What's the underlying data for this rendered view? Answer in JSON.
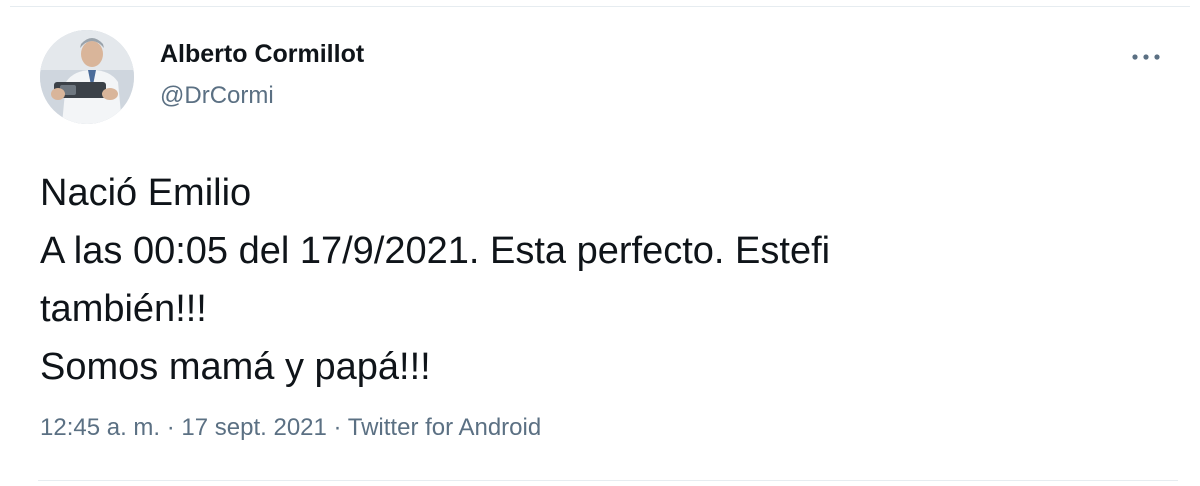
{
  "author": {
    "name": "Alberto Cormillot",
    "handle": "@DrCormi"
  },
  "menu_icon": "more-horizontal-icon",
  "body_lines": [
    "Nació Emilio",
    "A las 00:05 del 17/9/2021. Esta perfecto. Estefi",
    "también!!!",
    "Somos mamá y papá!!!"
  ],
  "meta": {
    "time": "12:45 a. m.",
    "separator": " · ",
    "date": "17 sept. 2021",
    "source": "Twitter for Android"
  },
  "colors": {
    "text": "#0f1419",
    "secondary": "#5b7083",
    "border": "#e6ecf0"
  }
}
